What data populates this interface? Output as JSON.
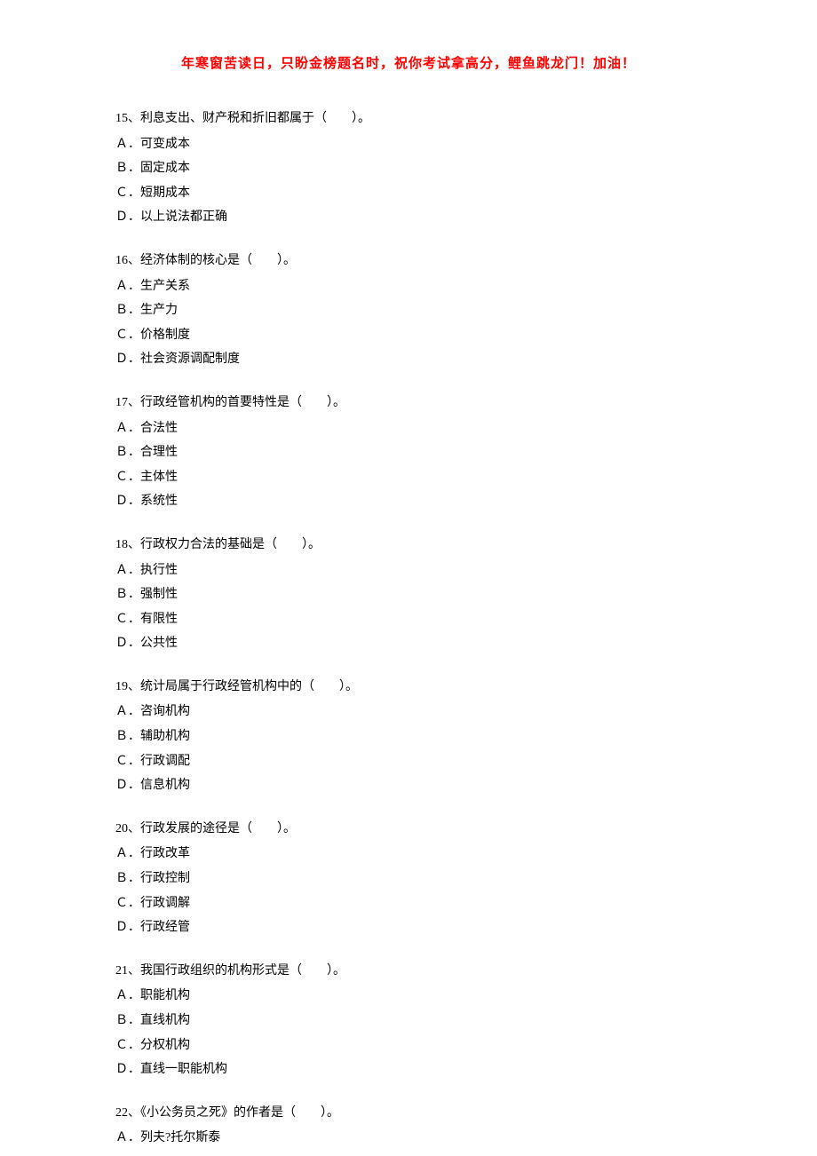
{
  "header": "年寒窗苦读日，只盼金榜题名时，祝你考试拿高分，鲤鱼跳龙门！加油！",
  "questions": [
    {
      "num": "15、",
      "text": "利息支出、财产税和折旧都属于（　　）。",
      "options": [
        "Ａ．可变成本",
        "Ｂ．固定成本",
        "Ｃ．短期成本",
        "Ｄ．以上说法都正确"
      ]
    },
    {
      "num": "16、",
      "text": "经济体制的核心是（　　）。",
      "options": [
        "Ａ．生产关系",
        "Ｂ．生产力",
        "Ｃ．价格制度",
        "Ｄ．社会资源调配制度"
      ]
    },
    {
      "num": "17、",
      "text": "行政经管机构的首要特性是（　　）。",
      "options": [
        "Ａ．合法性",
        "Ｂ．合理性",
        "Ｃ．主体性",
        "Ｄ．系统性"
      ]
    },
    {
      "num": "18、",
      "text": "行政权力合法的基础是（　　）。",
      "options": [
        "Ａ．执行性",
        "Ｂ．强制性",
        "Ｃ．有限性",
        "Ｄ．公共性"
      ]
    },
    {
      "num": "19、",
      "text": "统计局属于行政经管机构中的（　　）。",
      "options": [
        "Ａ．咨询机构",
        "Ｂ．辅助机构",
        "Ｃ．行政调配",
        "Ｄ．信息机构"
      ]
    },
    {
      "num": "20、",
      "text": "行政发展的途径是（　　）。",
      "options": [
        "Ａ．行政改革",
        "Ｂ．行政控制",
        "Ｃ．行政调解",
        "Ｄ．行政经管"
      ]
    },
    {
      "num": "21、",
      "text": "我国行政组织的机构形式是（　　）。",
      "options": [
        "Ａ．职能机构",
        "Ｂ．直线机构",
        "Ｃ．分权机构",
        "Ｄ．直线一职能机构"
      ]
    },
    {
      "num": "22、",
      "text": "《小公务员之死》的作者是（　　）。",
      "options": [
        "Ａ．列夫?托尔斯泰"
      ]
    }
  ]
}
